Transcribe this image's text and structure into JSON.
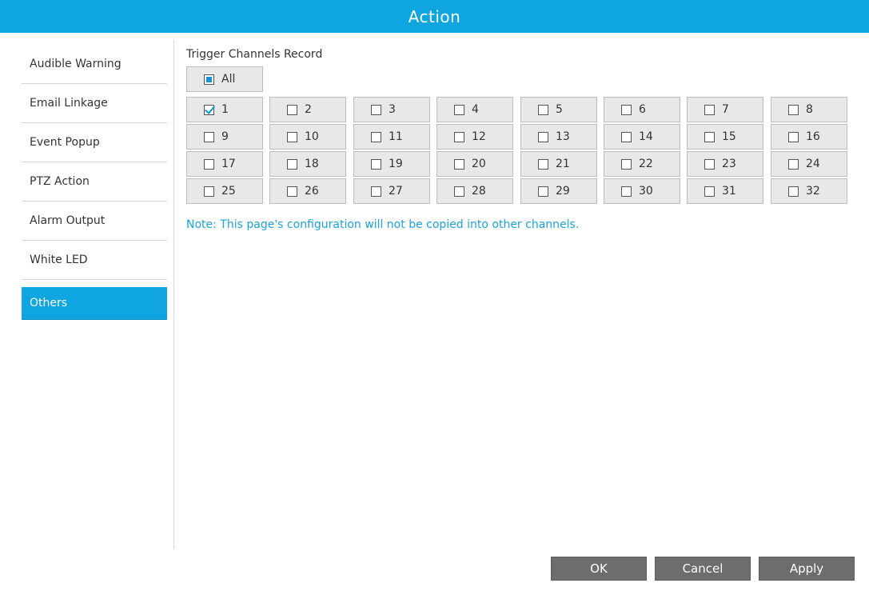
{
  "title": "Action",
  "sidebar": {
    "items": [
      {
        "label": "Audible Warning"
      },
      {
        "label": "Email Linkage"
      },
      {
        "label": "Event Popup"
      },
      {
        "label": "PTZ Action"
      },
      {
        "label": "Alarm Output"
      },
      {
        "label": "White LED"
      },
      {
        "label": "Others"
      }
    ],
    "active_index": 6
  },
  "section": {
    "title": "Trigger Channels Record",
    "all_label": "All",
    "all_state": "partial"
  },
  "channels": [
    {
      "label": "1",
      "checked": true
    },
    {
      "label": "2",
      "checked": false
    },
    {
      "label": "3",
      "checked": false
    },
    {
      "label": "4",
      "checked": false
    },
    {
      "label": "5",
      "checked": false
    },
    {
      "label": "6",
      "checked": false
    },
    {
      "label": "7",
      "checked": false
    },
    {
      "label": "8",
      "checked": false
    },
    {
      "label": "9",
      "checked": false
    },
    {
      "label": "10",
      "checked": false
    },
    {
      "label": "11",
      "checked": false
    },
    {
      "label": "12",
      "checked": false
    },
    {
      "label": "13",
      "checked": false
    },
    {
      "label": "14",
      "checked": false
    },
    {
      "label": "15",
      "checked": false
    },
    {
      "label": "16",
      "checked": false
    },
    {
      "label": "17",
      "checked": false
    },
    {
      "label": "18",
      "checked": false
    },
    {
      "label": "19",
      "checked": false
    },
    {
      "label": "20",
      "checked": false
    },
    {
      "label": "21",
      "checked": false
    },
    {
      "label": "22",
      "checked": false
    },
    {
      "label": "23",
      "checked": false
    },
    {
      "label": "24",
      "checked": false
    },
    {
      "label": "25",
      "checked": false
    },
    {
      "label": "26",
      "checked": false
    },
    {
      "label": "27",
      "checked": false
    },
    {
      "label": "28",
      "checked": false
    },
    {
      "label": "29",
      "checked": false
    },
    {
      "label": "30",
      "checked": false
    },
    {
      "label": "31",
      "checked": false
    },
    {
      "label": "32",
      "checked": false
    }
  ],
  "note": "Note: This page's configuration will not be copied into other channels.",
  "buttons": {
    "ok": "OK",
    "cancel": "Cancel",
    "apply": "Apply"
  },
  "colors": {
    "accent": "#0ea5e0",
    "button_bg": "#6d6d6d",
    "note_text": "#1aa3dc"
  }
}
